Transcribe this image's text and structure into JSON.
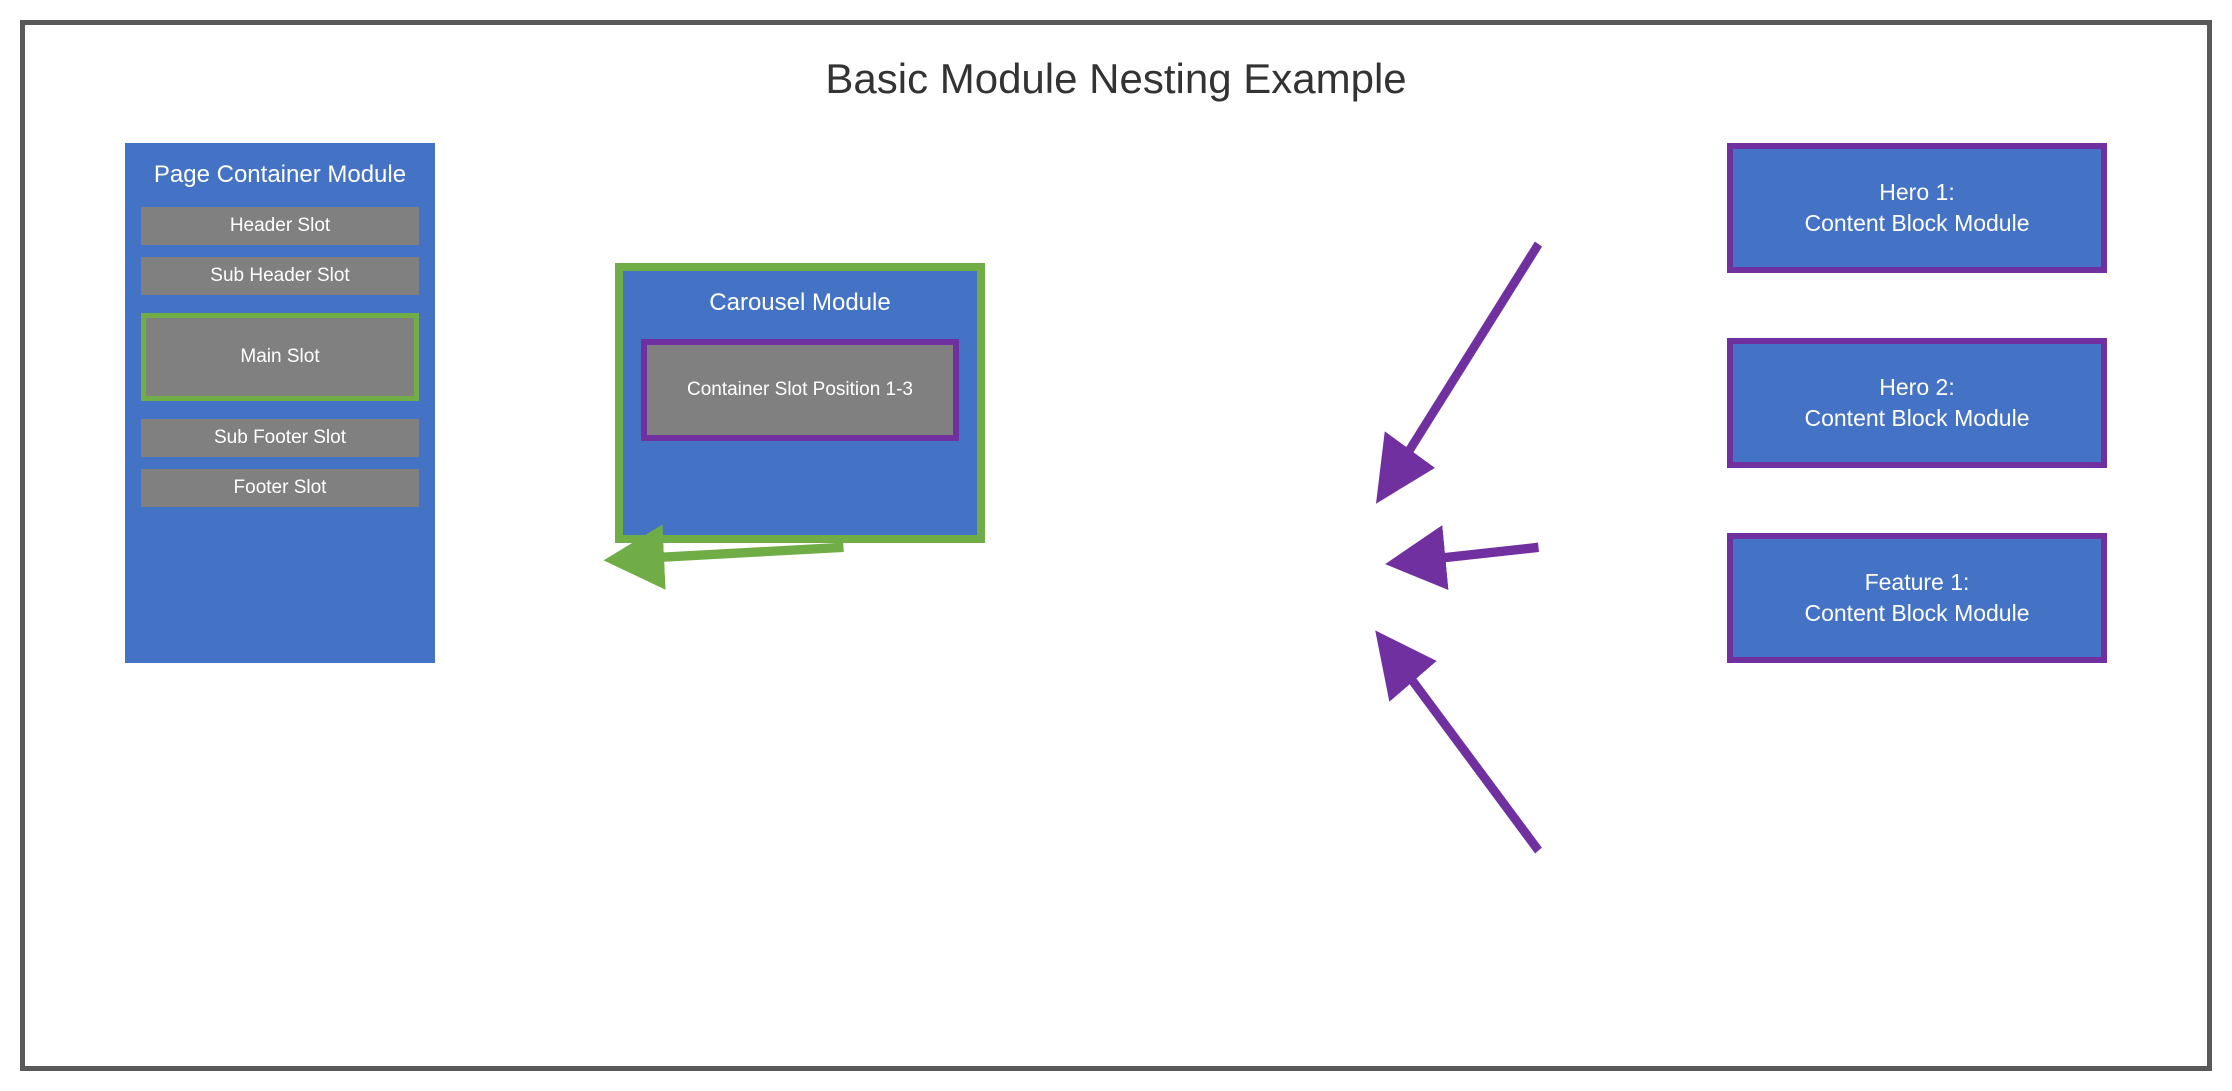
{
  "title": "Basic Module Nesting Example",
  "pageContainer": {
    "title": "Page Container Module",
    "slots": {
      "header": "Header Slot",
      "subHeader": "Sub Header Slot",
      "main": "Main Slot",
      "subFooter": "Sub Footer Slot",
      "footer": "Footer Slot"
    }
  },
  "carousel": {
    "title": "Carousel Module",
    "slot": "Container Slot Position 1-3"
  },
  "blocks": {
    "hero1": {
      "line1": "Hero 1:",
      "line2": "Content Block Module"
    },
    "hero2": {
      "line1": "Hero 2:",
      "line2": "Content Block Module"
    },
    "feature1": {
      "line1": "Feature 1:",
      "line2": "Content Block Module"
    }
  },
  "colors": {
    "moduleFill": "#4472C4",
    "slotFill": "#808080",
    "greenBorder": "#70AD47",
    "purpleBorder": "#7030A0",
    "frameBorder": "#595959"
  }
}
